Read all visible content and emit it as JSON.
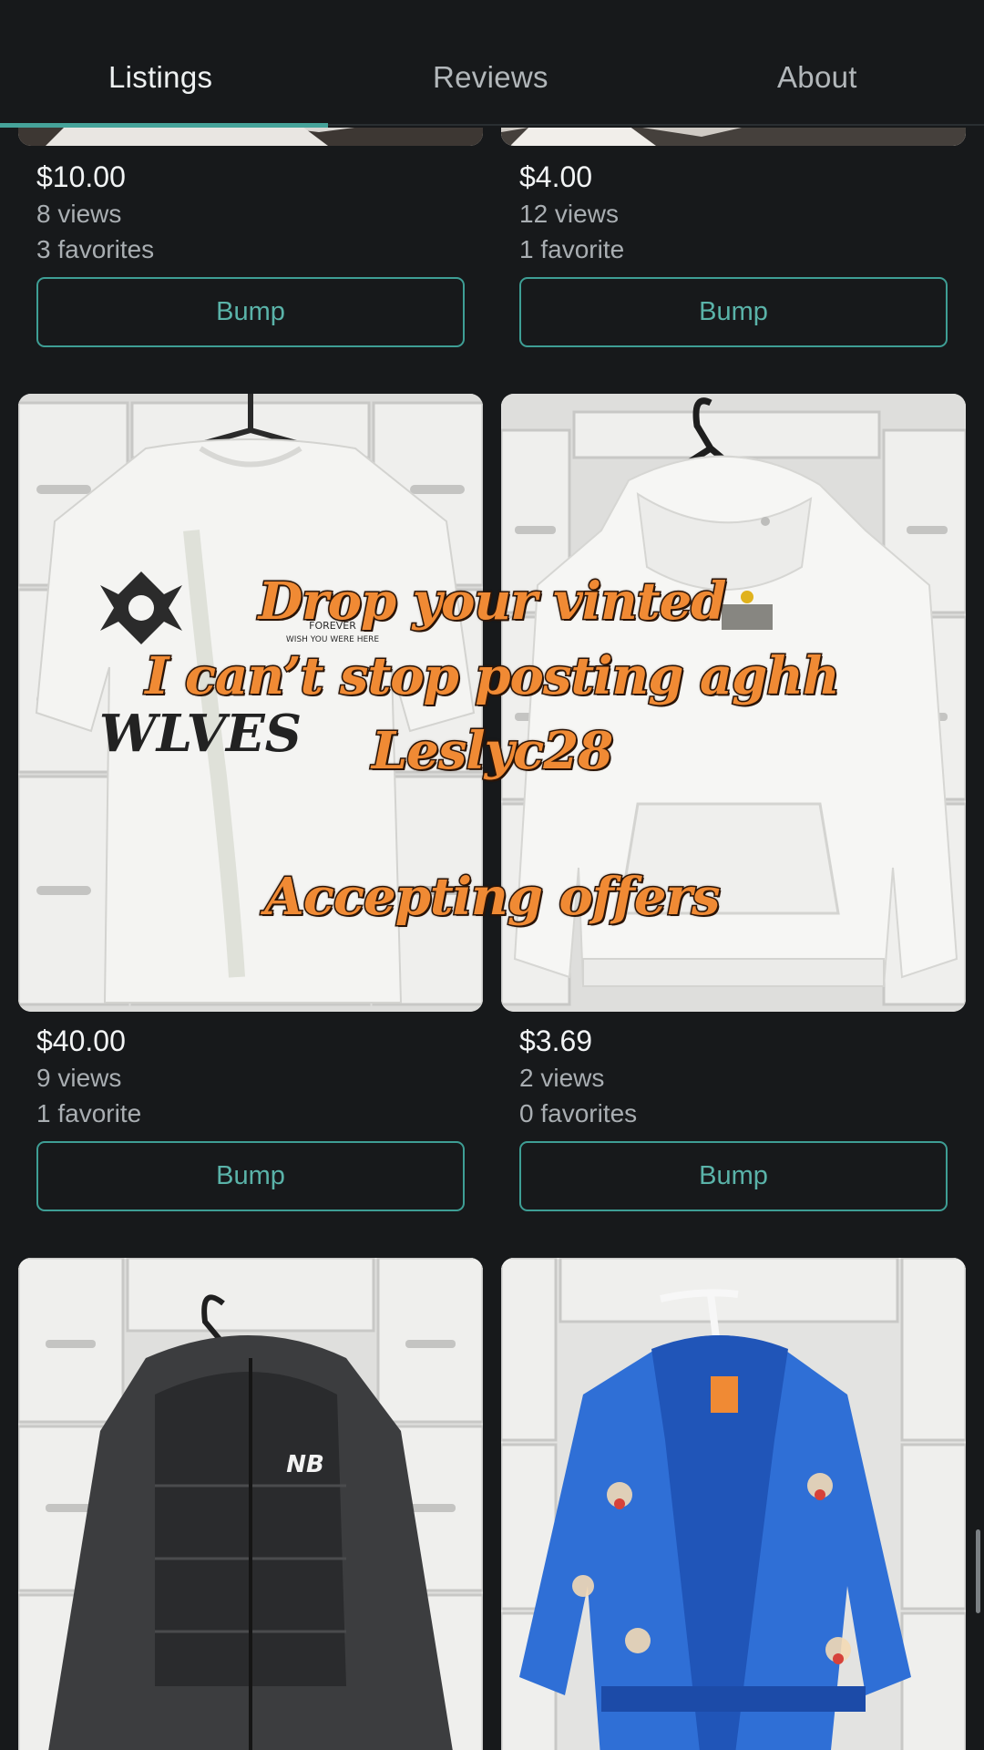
{
  "tabs": [
    {
      "label": "Listings",
      "active": true
    },
    {
      "label": "Reviews",
      "active": false
    },
    {
      "label": "About",
      "active": false
    }
  ],
  "listings": [
    {
      "price": "$10.00",
      "views": "8 views",
      "favorites": "3 favorites",
      "action": "Bump"
    },
    {
      "price": "$4.00",
      "views": "12 views",
      "favorites": "1 favorite",
      "action": "Bump"
    },
    {
      "price": "$40.00",
      "views": "9 views",
      "favorites": "1 favorite",
      "action": "Bump"
    },
    {
      "price": "$3.69",
      "views": "2 views",
      "favorites": "0 favorites",
      "action": "Bump"
    }
  ],
  "overlay_caption": {
    "line1": "Drop your vinted",
    "line2": "I can’t stop posting aghh",
    "line3": "Leslyc28",
    "line4": "Accepting offers"
  },
  "photo_print": {
    "tshirt_crest_text": "FOREVER",
    "tshirt_crest_sub": "WISH YOU WERE HERE",
    "tshirt_gothic_text": "WLVES",
    "jacket_logo": "NB"
  },
  "colors": {
    "background": "#17191b",
    "accent": "#46a39a",
    "overlay_text": "#f08a34"
  }
}
